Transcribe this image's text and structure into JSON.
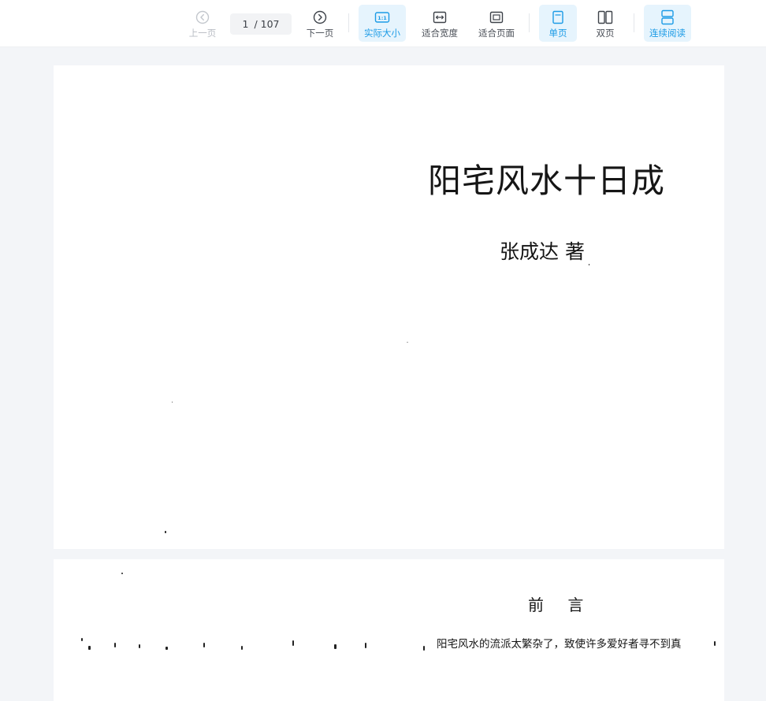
{
  "toolbar": {
    "prev_label": "上一页",
    "next_label": "下一页",
    "current_page": "1",
    "total_pages": "/ 107",
    "actual_size_label": "实际大小",
    "actual_size_badge": "1:1",
    "fit_width_label": "适合宽度",
    "fit_page_label": "适合页面",
    "single_page_label": "单页",
    "double_page_label": "双页",
    "continuous_label": "连续阅读",
    "colors": {
      "accent": "#1c9be6",
      "active_bg": "#e6f4fd",
      "disabled": "#b9bdc4"
    }
  },
  "document": {
    "page1": {
      "title": "阳宅风水十日成",
      "author": "张成达 著"
    },
    "page2": {
      "heading": "前 言",
      "first_line": "阳宅风水的流派太繁杂了，致使许多爱好者寻不到真"
    }
  }
}
